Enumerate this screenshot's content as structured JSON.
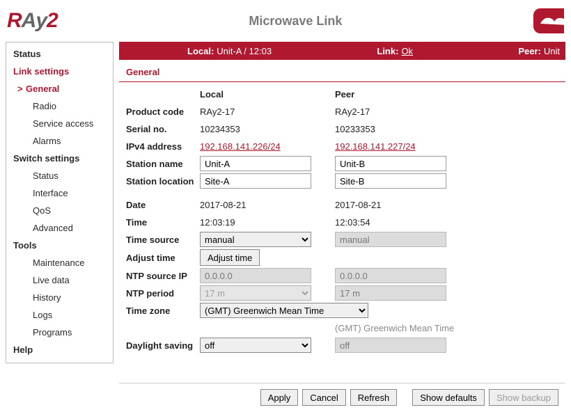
{
  "header": {
    "app_title": "Microwave Link"
  },
  "status_bar": {
    "local_label": "Local:",
    "local_value": "Unit-A / 12:03",
    "link_label": "Link:",
    "link_value": "Ok",
    "peer_label": "Peer:",
    "peer_value": "Unit"
  },
  "sidebar": {
    "status": "Status",
    "link_settings": "Link settings",
    "general": "General",
    "radio": "Radio",
    "service_access": "Service access",
    "alarms": "Alarms",
    "switch_settings": "Switch settings",
    "sw_status": "Status",
    "interface": "Interface",
    "qos": "QoS",
    "advanced": "Advanced",
    "tools": "Tools",
    "maintenance": "Maintenance",
    "live_data": "Live data",
    "history": "History",
    "logs": "Logs",
    "programs": "Programs",
    "help": "Help"
  },
  "section_title": "General",
  "columns": {
    "local": "Local",
    "peer": "Peer"
  },
  "fields": {
    "product_code": {
      "label": "Product code",
      "local": "RAy2-17",
      "peer": "RAy2-17"
    },
    "serial_no": {
      "label": "Serial no.",
      "local": "10234353",
      "peer": "10233353"
    },
    "ipv4": {
      "label": "IPv4 address",
      "local": "192.168.141.226/24",
      "peer": "192.168.141.227/24"
    },
    "station_name": {
      "label": "Station name",
      "local": "Unit-A",
      "peer": "Unit-B"
    },
    "station_location": {
      "label": "Station location",
      "local": "Site-A",
      "peer": "Site-B"
    },
    "date": {
      "label": "Date",
      "local": "2017-08-21",
      "peer": "2017-08-21"
    },
    "time": {
      "label": "Time",
      "local": "12:03:19",
      "peer": "12:03:54"
    },
    "time_source": {
      "label": "Time source",
      "local": "manual",
      "peer": "manual"
    },
    "adjust_time": {
      "label": "Adjust time",
      "button": "Adjust time"
    },
    "ntp_source": {
      "label": "NTP source IP",
      "local": "0.0.0.0",
      "peer": "0.0.0.0"
    },
    "ntp_period": {
      "label": "NTP period",
      "local": "17 m",
      "peer": "17 m"
    },
    "time_zone": {
      "label": "Time zone",
      "local": "(GMT) Greenwich Mean Time",
      "peer": "(GMT) Greenwich Mean Time"
    },
    "daylight": {
      "label": "Daylight saving",
      "local": "off",
      "peer": "off"
    }
  },
  "buttons": {
    "apply": "Apply",
    "cancel": "Cancel",
    "refresh": "Refresh",
    "show_defaults": "Show defaults",
    "show_backup": "Show backup"
  }
}
